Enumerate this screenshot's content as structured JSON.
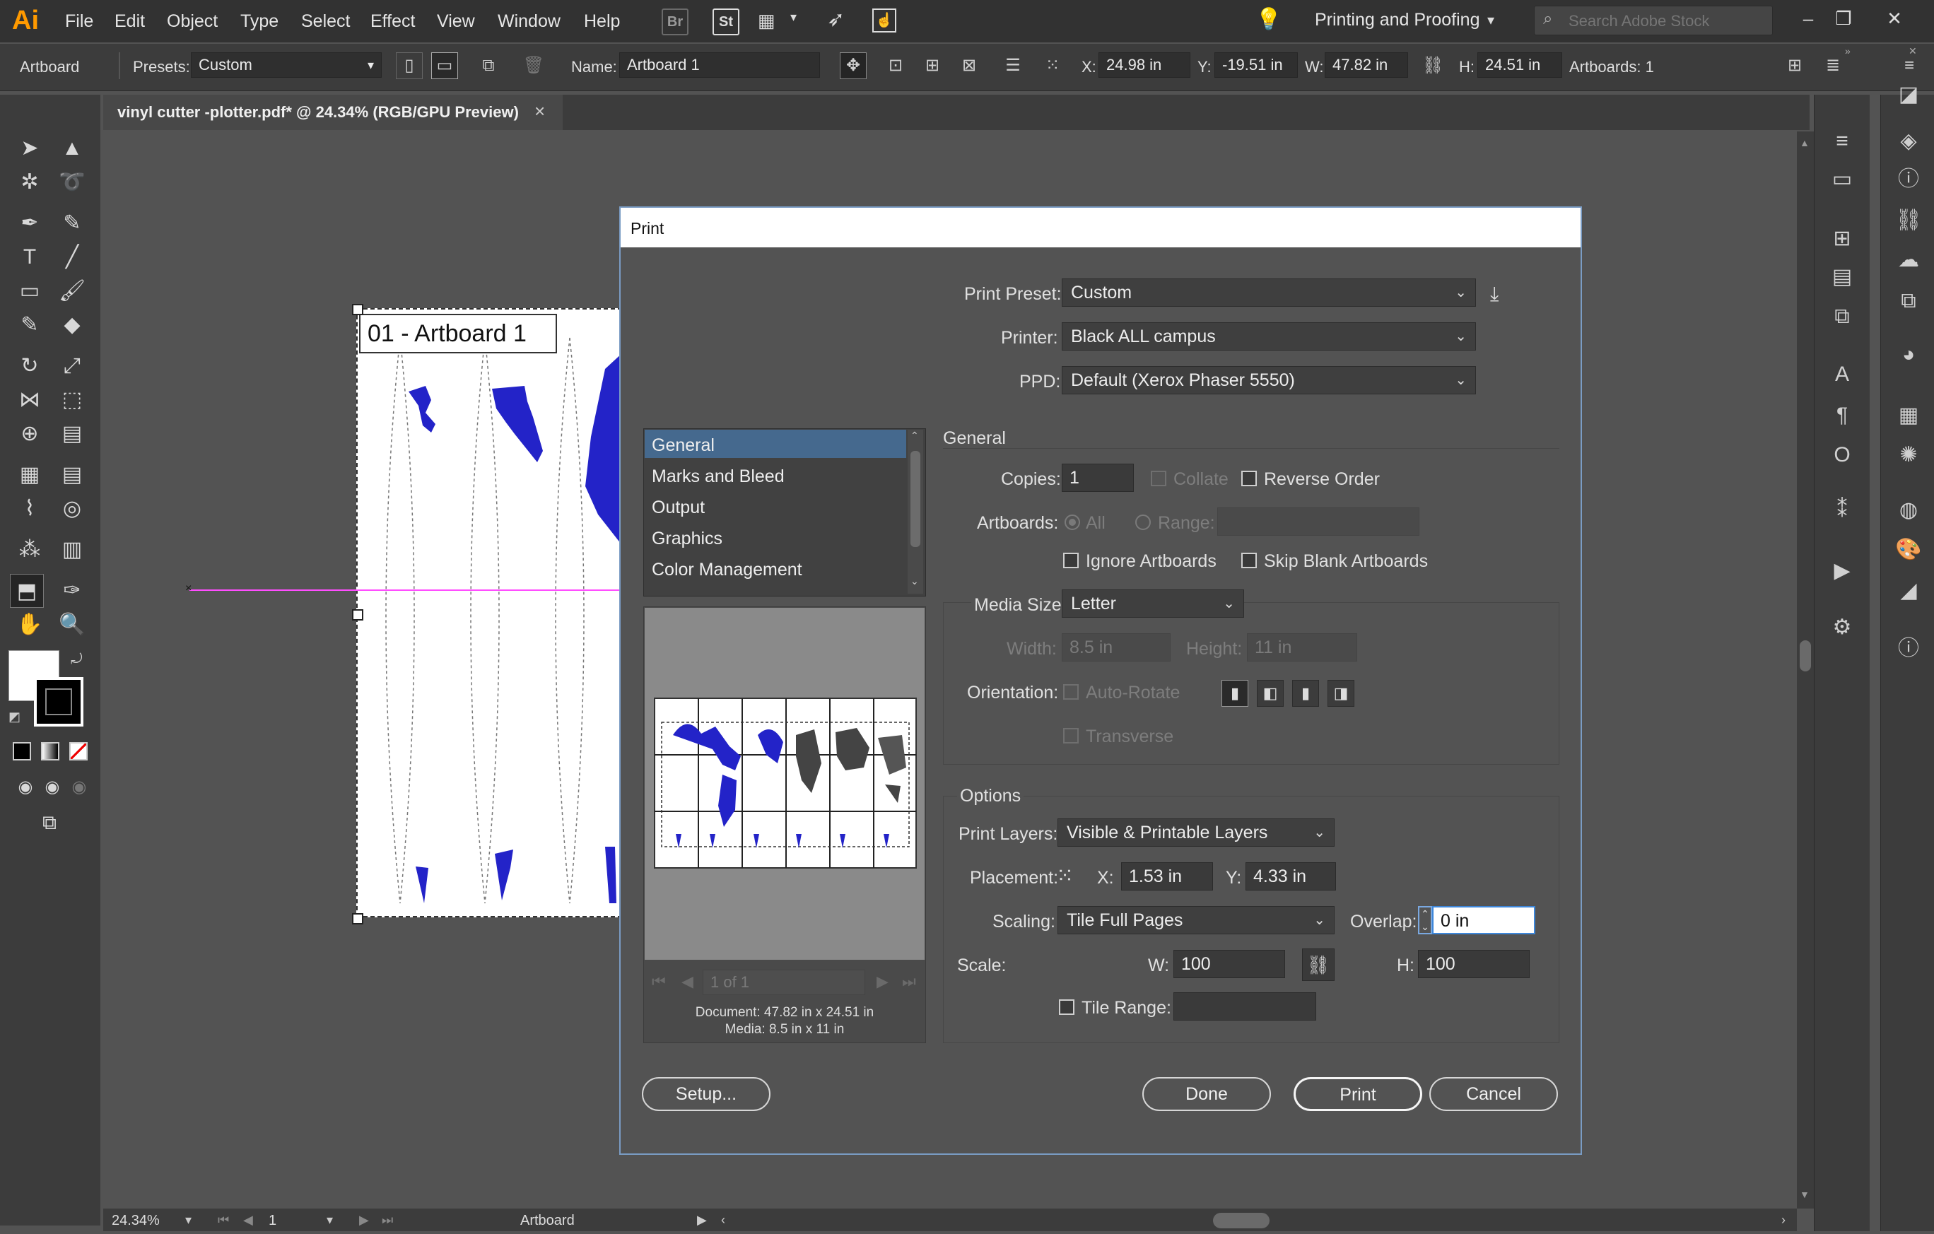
{
  "app": {
    "logo": "Ai",
    "workspace": "Printing and Proofing",
    "stock_placeholder": "Search Adobe Stock"
  },
  "menu": [
    "File",
    "Edit",
    "Object",
    "Type",
    "Select",
    "Effect",
    "View",
    "Window",
    "Help"
  ],
  "menubar_buttons": {
    "bridge": "Br",
    "stock": "St"
  },
  "controlbar": {
    "mode": "Artboard",
    "presets_label": "Presets:",
    "presets_value": "Custom",
    "name_label": "Name:",
    "name_value": "Artboard 1",
    "x_label": "X:",
    "x_value": "24.98 in",
    "y_label": "Y:",
    "y_value": "-19.51 in",
    "w_label": "W:",
    "w_value": "47.82 in",
    "h_label": "H:",
    "h_value": "24.51 in",
    "artboards": "Artboards: 1"
  },
  "document_tab": {
    "title": "vinyl cutter -plotter.pdf* @ 24.34% (RGB/GPU Preview)",
    "close": "×"
  },
  "artboard_label": "01 - Artboard 1",
  "status": {
    "zoom": "24.34%",
    "page": "1",
    "mode": "Artboard"
  },
  "print_dialog": {
    "title": "Print",
    "print_preset_label": "Print Preset:",
    "print_preset_value": "Custom",
    "printer_label": "Printer:",
    "printer_value": "Black ALL campus",
    "ppd_label": "PPD:",
    "ppd_value": "Default (Xerox Phaser 5550)",
    "categories": [
      "General",
      "Marks and Bleed",
      "Output",
      "Graphics",
      "Color Management"
    ],
    "general_heading": "General",
    "copies_label": "Copies:",
    "copies_value": "1",
    "collate_label": "Collate",
    "reverse_order_label": "Reverse Order",
    "artboards_label": "Artboards:",
    "all_label": "All",
    "range_label": "Range:",
    "ignore_artboards_label": "Ignore Artboards",
    "skip_blank_label": "Skip Blank Artboards",
    "media_size_label": "Media Size:",
    "media_size_value": "Letter",
    "width_label": "Width:",
    "width_value": "8.5 in",
    "height_label": "Height:",
    "height_value": "11 in",
    "orientation_label": "Orientation:",
    "auto_rotate_label": "Auto-Rotate",
    "transverse_label": "Transverse",
    "options_heading": "Options",
    "print_layers_label": "Print Layers:",
    "print_layers_value": "Visible & Printable Layers",
    "placement_label": "Placement:",
    "px_label": "X:",
    "px_value": "1.53 in",
    "py_label": "Y:",
    "py_value": "4.33 in",
    "scaling_label": "Scaling:",
    "scaling_value": "Tile Full Pages",
    "overlap_label": "Overlap:",
    "overlap_value": "0 in",
    "scale_label": "Scale:",
    "sw_label": "W:",
    "sw_value": "100",
    "sh_label": "H:",
    "sh_value": "100",
    "tile_range_label": "Tile Range:",
    "preview_page": "1 of 1",
    "document_info": "Document: 47.82 in x 24.51 in",
    "media_info": "Media: 8.5 in x 11 in",
    "setup_button": "Setup...",
    "done_button": "Done",
    "print_button": "Print",
    "cancel_button": "Cancel"
  },
  "colors": {
    "accent": "#ff9a00",
    "map_blue": "#2323c8",
    "guide": "#ff4dff",
    "dialog_border": "#7a9cc4"
  }
}
